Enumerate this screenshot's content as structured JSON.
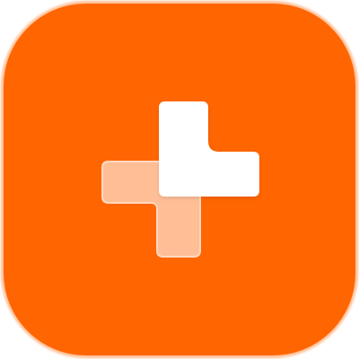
{
  "icon": {
    "name": "app-logo-icon",
    "colors": {
      "background": "#ffffff",
      "tile": "#FF6500",
      "tile_edge": "#FF8A3D",
      "front_shape": "#ffffff",
      "back_shape": "#FFC6A3",
      "back_shape_edge": "#FFE3D2"
    }
  }
}
